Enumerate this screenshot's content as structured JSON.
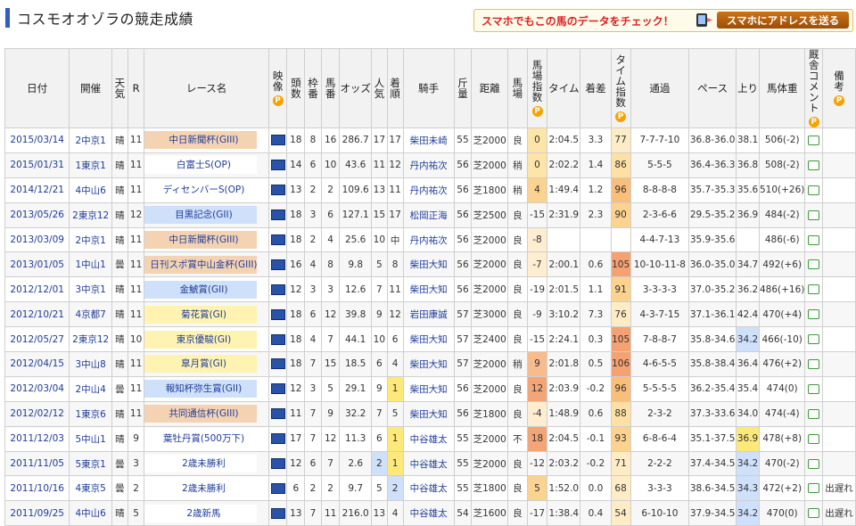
{
  "page": {
    "title": "コスモオオゾラの競走成績",
    "promo_text": "スマホでもこの馬のデータをチェック！",
    "send_button": "スマホにアドレスを送る"
  },
  "colors": {
    "G1": "#fef3b0",
    "G2": "#cfe0fb",
    "G3": "#f4d3b3",
    "OP": "#ffffff"
  },
  "headers": [
    "日付",
    "開催",
    "天気",
    "R",
    "レース名",
    "映像",
    "頭数",
    "枠番",
    "馬番",
    "オッズ",
    "人気",
    "着順",
    "騎手",
    "斤量",
    "距離",
    "馬場",
    "馬場指数",
    "タイム",
    "着差",
    "タイム指数",
    "通過",
    "ペース",
    "上り",
    "馬体重",
    "厩舎コメント",
    "備考"
  ],
  "rows": [
    [
      "2015/03/14",
      "2中京1",
      "晴",
      "11",
      "中日新聞杯(GIII)",
      "",
      "18",
      "8",
      "16",
      "286.7",
      "17",
      "17",
      "柴田未崎",
      "55",
      "芝2000",
      "良",
      "0",
      "2:04.5",
      "3.3",
      "77",
      "7-7-7-10",
      "36.8-36.0",
      "38.1",
      "506(-2)",
      "",
      ""
    ],
    [
      "2015/01/31",
      "1東京1",
      "晴",
      "11",
      "白富士S(OP)",
      "",
      "14",
      "6",
      "10",
      "43.6",
      "11",
      "12",
      "丹内祐次",
      "56",
      "芝2000",
      "稍",
      "0",
      "2:02.2",
      "1.4",
      "86",
      "5-5-5",
      "36.4-36.3",
      "36.8",
      "508(-2)",
      "",
      ""
    ],
    [
      "2014/12/21",
      "4中山6",
      "晴",
      "11",
      "ディセンバーS(OP)",
      "",
      "13",
      "2",
      "2",
      "109.6",
      "13",
      "11",
      "丹内祐次",
      "56",
      "芝1800",
      "稍",
      "4",
      "1:49.4",
      "1.2",
      "96",
      "8-8-8-8",
      "35.7-35.3",
      "35.6",
      "510(+26)",
      "",
      ""
    ],
    [
      "2013/05/26",
      "2東京12",
      "晴",
      "12",
      "目黒記念(GII)",
      "",
      "18",
      "3",
      "6",
      "127.1",
      "15",
      "17",
      "松岡正海",
      "56",
      "芝2500",
      "良",
      "-15",
      "2:31.9",
      "2.3",
      "90",
      "2-3-6-6",
      "29.5-35.2",
      "36.9",
      "484(-2)",
      "",
      ""
    ],
    [
      "2013/03/09",
      "2中京1",
      "晴",
      "11",
      "中日新聞杯(GIII)",
      "",
      "18",
      "2",
      "4",
      "25.6",
      "10",
      "中",
      "丹内祐次",
      "56",
      "芝2000",
      "良",
      "-8",
      "",
      "",
      "",
      "4-4-7-13",
      "35.9-35.6",
      "",
      "486(-6)",
      "",
      ""
    ],
    [
      "2013/01/05",
      "1中山1",
      "曇",
      "11",
      "日刊スポ賞中山金杯(GIII)",
      "",
      "16",
      "4",
      "8",
      "9.8",
      "5",
      "8",
      "柴田大知",
      "56",
      "芝2000",
      "良",
      "-7",
      "2:00.1",
      "0.6",
      "105",
      "10-10-11-8",
      "36.0-35.0",
      "34.7",
      "492(+6)",
      "",
      ""
    ],
    [
      "2012/12/01",
      "3中京1",
      "晴",
      "11",
      "金鯱賞(GII)",
      "",
      "12",
      "3",
      "3",
      "12.6",
      "7",
      "11",
      "柴田大知",
      "56",
      "芝2000",
      "良",
      "-19",
      "2:01.5",
      "1.1",
      "91",
      "3-3-3-3",
      "37.0-35.2",
      "36.2",
      "486(+16)",
      "",
      ""
    ],
    [
      "2012/10/21",
      "4京都7",
      "晴",
      "11",
      "菊花賞(GI)",
      "",
      "18",
      "6",
      "12",
      "39.8",
      "9",
      "12",
      "岩田康誠",
      "57",
      "芝3000",
      "良",
      "-9",
      "3:10.2",
      "7.3",
      "76",
      "4-3-7-15",
      "37.1-36.1",
      "42.4",
      "470(+4)",
      "",
      ""
    ],
    [
      "2012/05/27",
      "2東京12",
      "晴",
      "10",
      "東京優駿(GI)",
      "",
      "18",
      "4",
      "7",
      "44.1",
      "10",
      "6",
      "柴田大知",
      "57",
      "芝2400",
      "良",
      "-15",
      "2:24.1",
      "0.3",
      "105",
      "7-8-8-7",
      "35.8-34.6",
      "34.2",
      "466(-10)",
      "",
      ""
    ],
    [
      "2012/04/15",
      "3中山8",
      "晴",
      "11",
      "皐月賞(GI)",
      "",
      "18",
      "7",
      "15",
      "18.5",
      "6",
      "4",
      "柴田大知",
      "57",
      "芝2000",
      "稍",
      "9",
      "2:01.8",
      "0.5",
      "106",
      "4-6-5-5",
      "35.8-38.4",
      "36.4",
      "476(+2)",
      "",
      ""
    ],
    [
      "2012/03/04",
      "2中山4",
      "曇",
      "11",
      "報知杯弥生賞(GII)",
      "",
      "12",
      "3",
      "5",
      "29.1",
      "9",
      "1",
      "柴田大知",
      "56",
      "芝2000",
      "良",
      "12",
      "2:03.9",
      "-0.2",
      "96",
      "5-5-5-5",
      "36.2-35.4",
      "35.4",
      "474(0)",
      "",
      ""
    ],
    [
      "2012/02/12",
      "1東京6",
      "晴",
      "11",
      "共同通信杯(GIII)",
      "",
      "11",
      "7",
      "9",
      "32.2",
      "7",
      "5",
      "柴田大知",
      "56",
      "芝1800",
      "良",
      "-4",
      "1:48.9",
      "0.6",
      "88",
      "2-3-2",
      "37.3-33.6",
      "34.0",
      "474(-4)",
      "",
      ""
    ],
    [
      "2011/12/03",
      "5中山1",
      "晴",
      "9",
      "葉牡丹賞(500万下)",
      "",
      "17",
      "7",
      "12",
      "11.3",
      "6",
      "1",
      "中谷雄太",
      "55",
      "芝2000",
      "不",
      "18",
      "2:04.5",
      "-0.1",
      "93",
      "6-8-6-4",
      "35.1-37.5",
      "36.9",
      "478(+8)",
      "",
      ""
    ],
    [
      "2011/11/05",
      "5東京1",
      "曇",
      "3",
      "2歳未勝利",
      "",
      "12",
      "6",
      "7",
      "2.6",
      "2",
      "1",
      "中谷雄太",
      "55",
      "芝2000",
      "良",
      "-12",
      "2:03.2",
      "-0.2",
      "71",
      "2-2-2",
      "37.4-34.5",
      "34.2",
      "470(-2)",
      "",
      ""
    ],
    [
      "2011/10/16",
      "4東京5",
      "曇",
      "2",
      "2歳未勝利",
      "",
      "6",
      "2",
      "2",
      "9.7",
      "5",
      "2",
      "中谷雄太",
      "55",
      "芝1800",
      "良",
      "5",
      "1:52.0",
      "0.0",
      "68",
      "3-3-3",
      "38.6-34.5",
      "34.3",
      "472(+2)",
      "",
      "出遅れ"
    ],
    [
      "2011/09/25",
      "4中山6",
      "晴",
      "5",
      "2歳新馬",
      "",
      "13",
      "7",
      "11",
      "216.0",
      "13",
      "4",
      "中谷雄太",
      "54",
      "芝1600",
      "良",
      "-17",
      "1:38.4",
      "0.4",
      "54",
      "6-10-10",
      "37.9-34.5",
      "34.2",
      "470(0)",
      "",
      "出遅れ"
    ]
  ]
}
